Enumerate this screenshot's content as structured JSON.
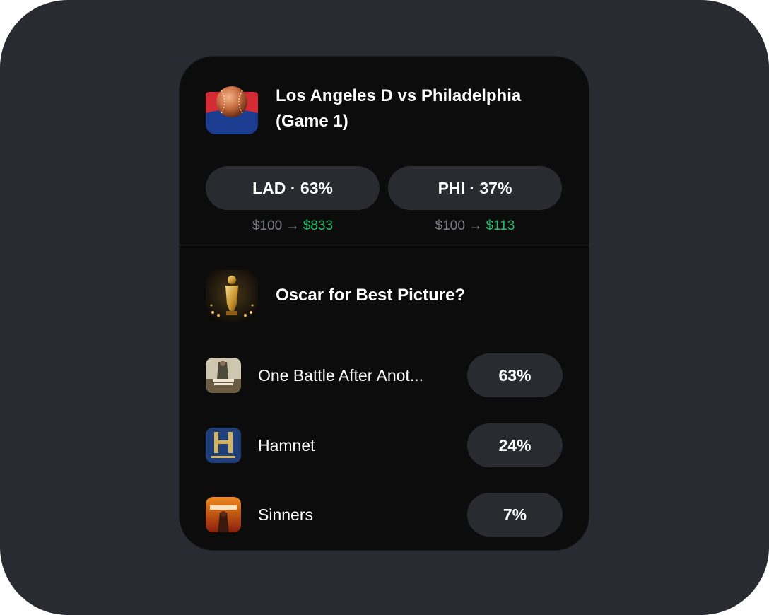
{
  "market1": {
    "icon": "baseball-icon",
    "title": "Los Angeles D vs Philadelphia (Game 1)",
    "outcomes": [
      {
        "label": "LAD · 63%",
        "stake": "$100 →",
        "payout": "$833"
      },
      {
        "label": "PHI · 37%",
        "stake": "$100 →",
        "payout": "$113"
      }
    ]
  },
  "market2": {
    "icon": "oscar-statue-icon",
    "title": "Oscar for Best Picture?",
    "options": [
      {
        "label": "One Battle After Anot...",
        "percent": "63%",
        "icon": "one-battle-poster-icon"
      },
      {
        "label": "Hamnet",
        "percent": "24%",
        "icon": "hamnet-poster-icon"
      },
      {
        "label": "Sinners",
        "percent": "7%",
        "icon": "sinners-poster-icon"
      }
    ]
  },
  "colors": {
    "background": "#292b32",
    "card": "#0c0c0d",
    "pill": "#2a2b31",
    "positive": "#1fbf6b",
    "muted": "#7d8089"
  }
}
